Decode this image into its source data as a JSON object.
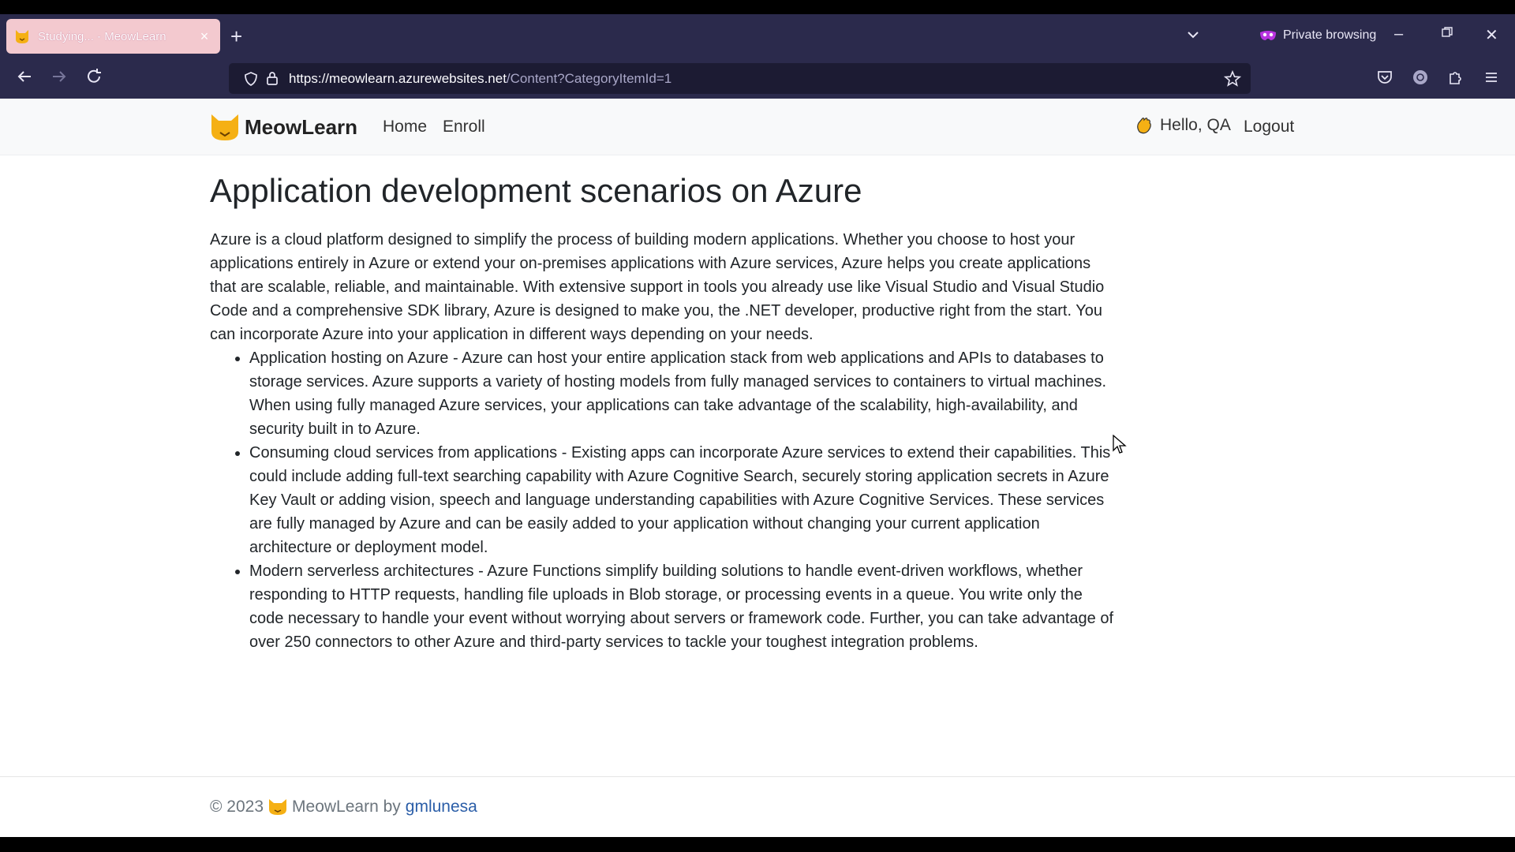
{
  "browser": {
    "tab_title": "Studying... - MeowLearn",
    "url_host": "https://meowlearn.azurewebsites.net",
    "url_path": "/Content?CategoryItemId=1",
    "private_label": "Private browsing"
  },
  "site": {
    "brand": "MeowLearn",
    "nav": [
      {
        "label": "Home"
      },
      {
        "label": "Enroll"
      }
    ],
    "greeting": "Hello, QA",
    "logout": "Logout"
  },
  "article": {
    "title": "Application development scenarios on Azure",
    "intro": "Azure is a cloud platform designed to simplify the process of building modern applications. Whether you choose to host your applications entirely in Azure or extend your on-premises applications with Azure services, Azure helps you create applications that are scalable, reliable, and maintainable. With extensive support in tools you already use like Visual Studio and Visual Studio Code and a comprehensive SDK library, Azure is designed to make you, the .NET developer, productive right from the start. You can incorporate Azure into your application in different ways depending on your needs.",
    "bullets": [
      "Application hosting on Azure - Azure can host your entire application stack from web applications and APIs to databases to storage services. Azure supports a variety of hosting models from fully managed services to containers to virtual machines. When using fully managed Azure services, your applications can take advantage of the scalability, high-availability, and security built in to Azure.",
      "Consuming cloud services from applications - Existing apps can incorporate Azure services to extend their capabilities. This could include adding full-text searching capability with Azure Cognitive Search, securely storing application secrets in Azure Key Vault or adding vision, speech and language understanding capabilities with Azure Cognitive Services. These services are fully managed by Azure and can be easily added to your application without changing your current application architecture or deployment model.",
      "Modern serverless architectures - Azure Functions simplify building solutions to handle event-driven workflows, whether responding to HTTP requests, handling file uploads in Blob storage, or processing events in a queue. You write only the code necessary to handle your event without worrying about servers or framework code. Further, you can take advantage of over 250 connectors to other Azure and third-party services to tackle your toughest integration problems."
    ]
  },
  "footer": {
    "copyright": "© 2023",
    "brand": "MeowLearn by",
    "author": "gmlunesa"
  },
  "colors": {
    "browser_chrome": "#2b2a4c",
    "brand_orange": "#f5b014",
    "link_blue": "#2b5ea8"
  }
}
